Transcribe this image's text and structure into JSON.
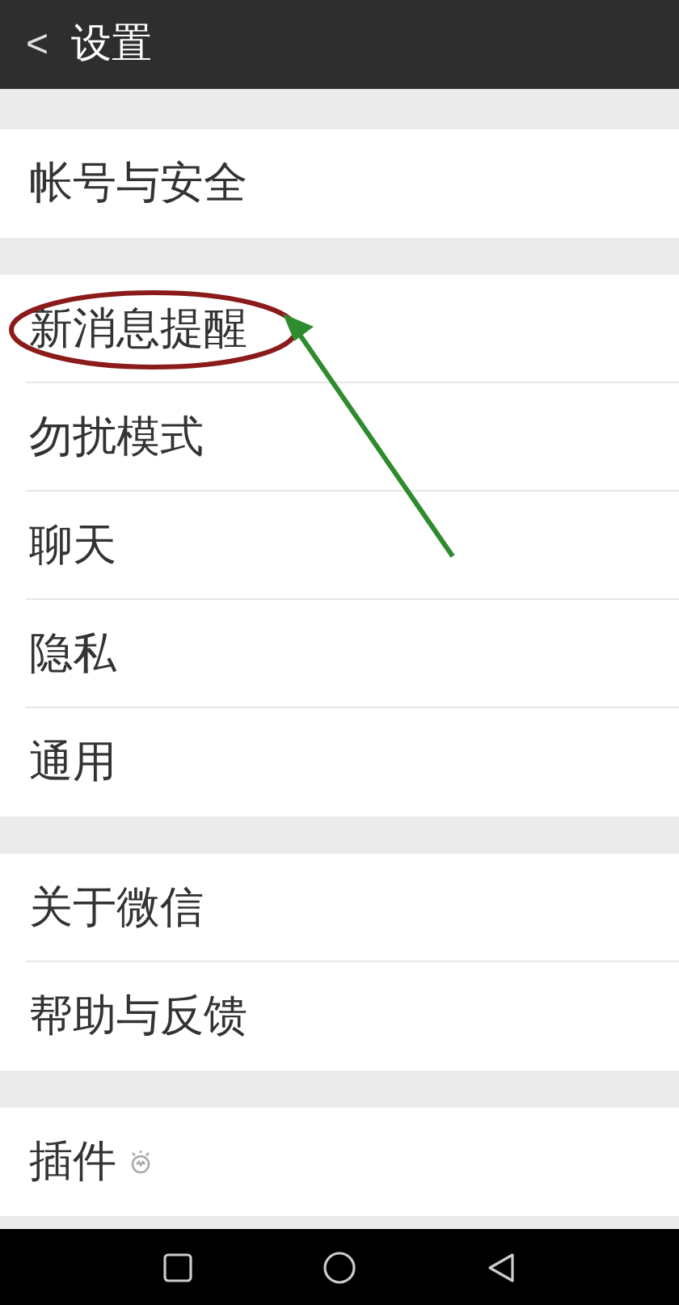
{
  "header": {
    "back": "<",
    "title": "设置"
  },
  "groups": [
    {
      "items": [
        {
          "label": "帐号与安全",
          "highlighted": false,
          "kind": "plain"
        }
      ]
    },
    {
      "items": [
        {
          "label": "新消息提醒",
          "highlighted": true,
          "kind": "plain"
        },
        {
          "label": "勿扰模式",
          "highlighted": false,
          "kind": "plain"
        },
        {
          "label": "聊天",
          "highlighted": false,
          "kind": "plain"
        },
        {
          "label": "隐私",
          "highlighted": false,
          "kind": "plain"
        },
        {
          "label": "通用",
          "highlighted": false,
          "kind": "plain"
        }
      ]
    },
    {
      "items": [
        {
          "label": "关于微信",
          "highlighted": false,
          "kind": "plain"
        },
        {
          "label": "帮助与反馈",
          "highlighted": false,
          "kind": "plain"
        }
      ]
    },
    {
      "items": [
        {
          "label": "插件",
          "highlighted": false,
          "kind": "with-icon"
        }
      ]
    }
  ]
}
